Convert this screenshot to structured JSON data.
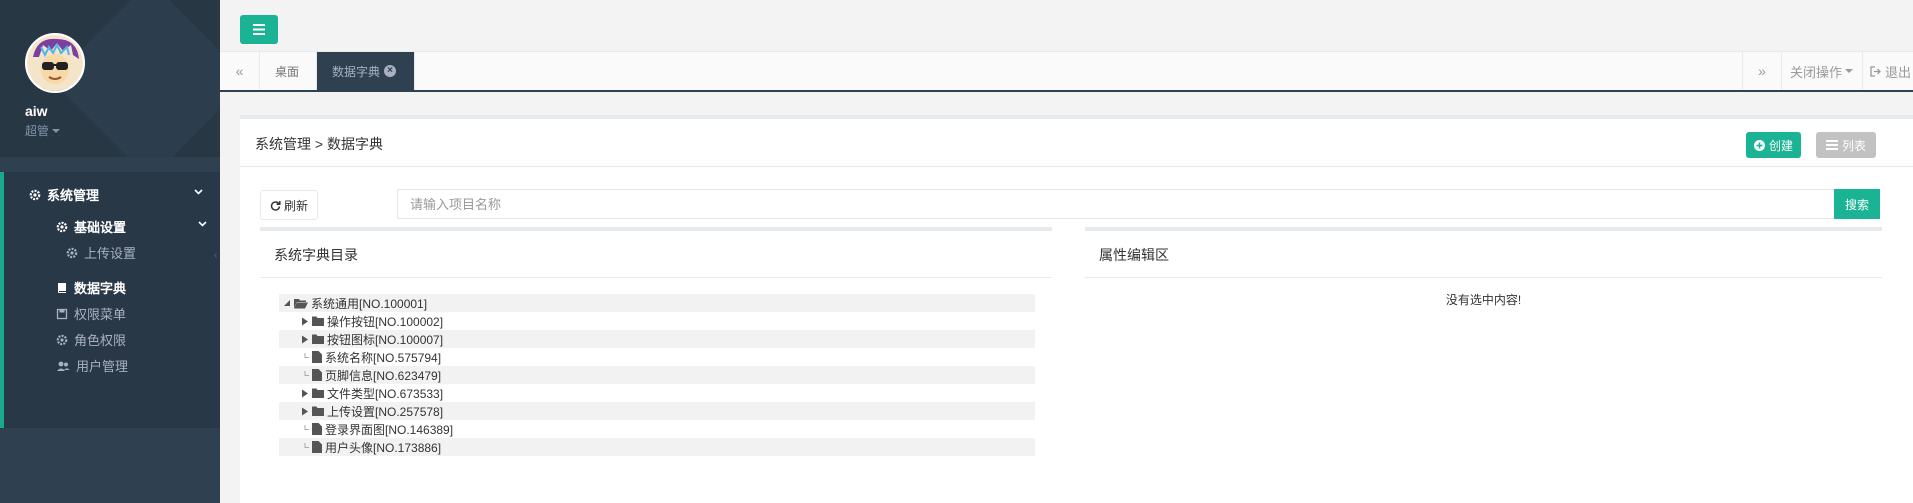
{
  "user": {
    "name": "aiw",
    "role": "超管"
  },
  "sidebar": {
    "groups": [
      {
        "label": "系统管理",
        "icon": "gear-icon"
      }
    ],
    "subgroup": {
      "label": "基础设置",
      "icon": "gear-icon"
    },
    "items": [
      {
        "label": "上传设置",
        "icon": "gear-icon"
      },
      {
        "label": "数据字典",
        "icon": "book-icon"
      },
      {
        "label": "权限菜单",
        "icon": "save-icon"
      },
      {
        "label": "角色权限",
        "icon": "gear-icon"
      },
      {
        "label": "用户管理",
        "icon": "users-icon"
      }
    ]
  },
  "tabs": {
    "prev": "«",
    "next": "»",
    "items": [
      {
        "label": "桌面"
      },
      {
        "label": "数据字典"
      }
    ],
    "close_ops": "关闭操作",
    "logout": "退出"
  },
  "main": {
    "breadcrumb": "系统管理 > 数据字典",
    "create_label": "创建",
    "list_label": "列表",
    "refresh_label": "刷新",
    "search_placeholder": "请输入项目名称",
    "search_label": "搜索"
  },
  "tree_panel": {
    "title": "系统字典目录",
    "nodes": [
      {
        "label": "系统通用[NO.100001]",
        "type": "folder-open",
        "level": 0
      },
      {
        "label": "操作按钮[NO.100002]",
        "type": "folder",
        "level": 1
      },
      {
        "label": "按钮图标[NO.100007]",
        "type": "folder",
        "level": 1
      },
      {
        "label": "系统名称[NO.575794]",
        "type": "file",
        "level": 1
      },
      {
        "label": "页脚信息[NO.623479]",
        "type": "file",
        "level": 1
      },
      {
        "label": "文件类型[NO.673533]",
        "type": "folder",
        "level": 1
      },
      {
        "label": "上传设置[NO.257578]",
        "type": "folder",
        "level": 1
      },
      {
        "label": "登录界面图[NO.146389]",
        "type": "file",
        "level": 1
      },
      {
        "label": "用户头像[NO.173886]",
        "type": "file",
        "level": 1
      }
    ]
  },
  "attr_panel": {
    "title": "属性编辑区",
    "empty_message": "没有选中内容!"
  },
  "colors": {
    "accent": "#1ab394",
    "sidebar": "#2f4050",
    "sidebar_dark": "#293846"
  }
}
